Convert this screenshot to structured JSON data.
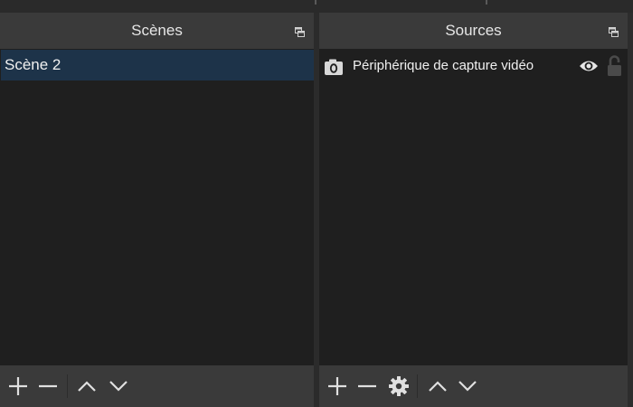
{
  "scenes_dock": {
    "title": "Scènes",
    "items": [
      {
        "label": "Scène 2",
        "selected": true
      }
    ],
    "toolbar": [
      "add",
      "remove",
      "move-up",
      "move-down"
    ]
  },
  "sources_dock": {
    "title": "Sources",
    "items": [
      {
        "label": "Périphérique de capture vidéo",
        "icon": "camera-icon",
        "visible": true,
        "locked": false
      }
    ],
    "toolbar": [
      "add",
      "remove",
      "properties",
      "move-up",
      "move-down"
    ]
  },
  "colors": {
    "dock_background": "#1f1f1f",
    "title_bar": "#3a3a3a",
    "selection": "#1d3349",
    "text": "#f0f0f0"
  }
}
